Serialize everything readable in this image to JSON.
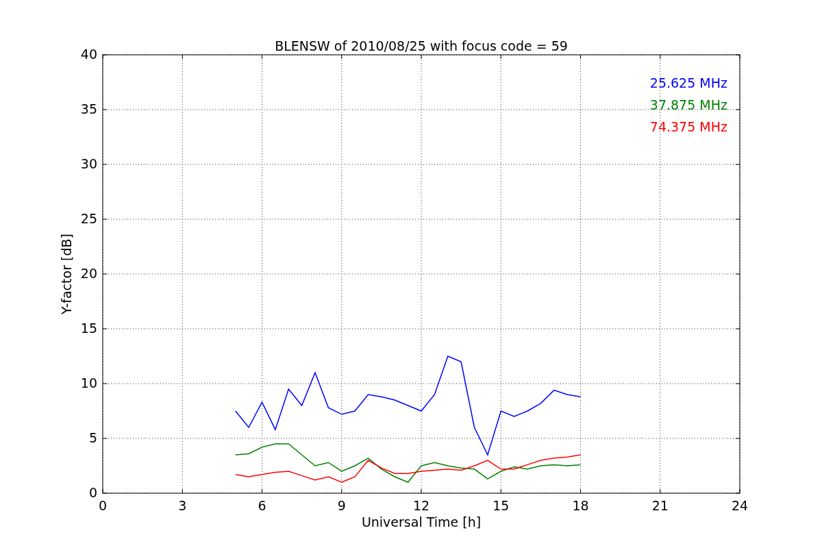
{
  "figure": {
    "chart_data": {
      "type": "line",
      "title": "BLENSW of 2010/08/25 with focus code = 59",
      "xlabel": "Universal Time [h]",
      "ylabel": "Y-factor [dB]",
      "x": [
        5,
        5.5,
        6,
        6.5,
        7,
        7.5,
        8,
        8.5,
        9,
        9.5,
        10,
        10.5,
        11,
        11.5,
        12,
        12.5,
        13,
        13.5,
        14,
        14.5,
        15,
        15.5,
        16,
        16.5,
        17,
        17.5,
        18
      ],
      "series": [
        {
          "name": "25.625 MHz",
          "color": "#0000ff",
          "values": [
            7.5,
            6,
            8.3,
            5.8,
            9.5,
            8,
            11,
            7.8,
            7.2,
            7.5,
            9,
            8.8,
            8.5,
            8,
            7.5,
            9,
            12.5,
            12,
            6,
            3.5,
            7.5,
            7,
            7.5,
            8.2,
            9.4,
            9,
            8.8
          ]
        },
        {
          "name": "37.875 MHz",
          "color": "#008000",
          "values": [
            3.5,
            3.6,
            4.2,
            4.5,
            4.5,
            3.5,
            2.5,
            2.8,
            2,
            2.5,
            3.2,
            2.2,
            1.5,
            1,
            2.5,
            2.8,
            2.5,
            2.3,
            2.2,
            1.3,
            2,
            2.4,
            2.2,
            2.5,
            2.6,
            2.5,
            2.6
          ]
        },
        {
          "name": "74.375 MHz",
          "color": "#ff0000",
          "values": [
            1.7,
            1.5,
            1.7,
            1.9,
            2,
            1.6,
            1.2,
            1.5,
            1,
            1.5,
            3,
            2.3,
            1.8,
            1.8,
            2,
            2.1,
            2.2,
            2.1,
            2.5,
            3,
            2.2,
            2.2,
            2.6,
            3,
            3.2,
            3.3,
            3.5
          ]
        }
      ],
      "grid": true,
      "xlim": [
        0,
        24
      ],
      "ylim": [
        0,
        40
      ],
      "xticks": [
        0,
        3,
        6,
        9,
        12,
        15,
        18,
        21,
        24
      ],
      "yticks": [
        0,
        5,
        10,
        15,
        20,
        25,
        30,
        35,
        40
      ]
    }
  }
}
